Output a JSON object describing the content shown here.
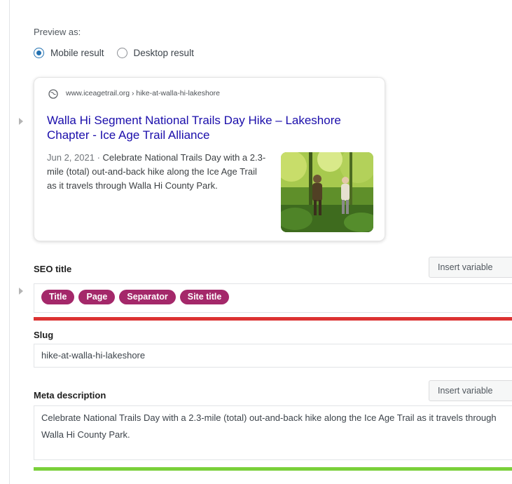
{
  "preview": {
    "label": "Preview as:",
    "options": [
      {
        "label": "Mobile result",
        "selected": true
      },
      {
        "label": "Desktop result",
        "selected": false
      }
    ]
  },
  "snippet": {
    "url": "www.iceagetrail.org › hike-at-walla-hi-lakeshore",
    "title": "Walla Hi Segment National Trails Day Hike – Lakeshore Chapter - Ice Age Trail Alliance",
    "date": "Jun 2, 2021",
    "separator": " · ",
    "description": "Celebrate National Trails Day with a 2.3-mile (total) out-and-back hike along the Ice Age Trail as it travels through Walla Hi County Park.",
    "title_color": "#1a0dab"
  },
  "seo_title": {
    "label": "SEO title",
    "insert_button": "Insert variable",
    "variables": [
      "Title",
      "Page",
      "Separator",
      "Site title"
    ],
    "pill_color": "#a4286a",
    "progress_color": "#dc3232"
  },
  "slug": {
    "label": "Slug",
    "value": "hike-at-walla-hi-lakeshore"
  },
  "meta": {
    "label": "Meta description",
    "insert_button": "Insert variable",
    "value": "Celebrate National Trails Day with a 2.3-mile (total) out-and-back hike along the Ice Age Trail as it travels through Walla Hi County Park.",
    "progress_color": "#7ad03a"
  }
}
